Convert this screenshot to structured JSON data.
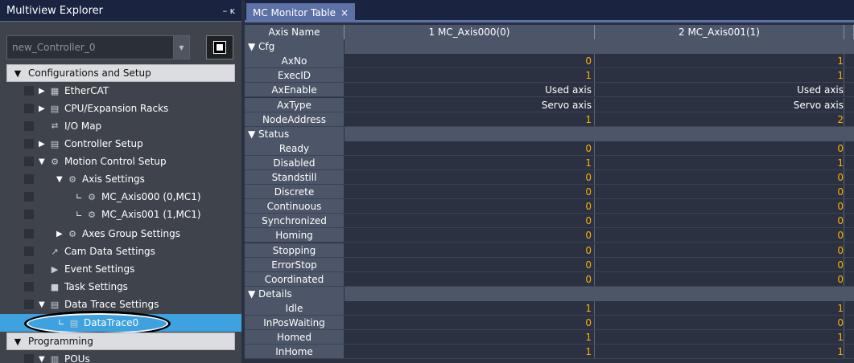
{
  "explorer": {
    "title": "Multiview Explorer",
    "pin_label": "– ĸ",
    "controller_select": "new_Controller_0",
    "sections": {
      "config": "Configurations and Setup",
      "programming": "Programming"
    },
    "tree": [
      {
        "label": "EtherCAT",
        "icon": "ethercat-icon",
        "glyph": "▦"
      },
      {
        "label": "CPU/Expansion Racks",
        "icon": "rack-icon",
        "glyph": "▤"
      },
      {
        "label": "I/O Map",
        "icon": "io-map-icon",
        "glyph": "⮂"
      },
      {
        "label": "Controller Setup",
        "icon": "controller-setup-icon",
        "glyph": "▤"
      },
      {
        "label": "Motion Control Setup",
        "icon": "motion-gear-icon",
        "glyph": "⚙"
      },
      {
        "label": "Axis Settings",
        "icon": "axis-gear-icon",
        "glyph": "⚙"
      },
      {
        "label": "MC_Axis000 (0,MC1)",
        "icon": "axis-icon",
        "glyph": "⚙"
      },
      {
        "label": "MC_Axis001 (1,MC1)",
        "icon": "axis-icon",
        "glyph": "⚙"
      },
      {
        "label": "Axes Group Settings",
        "icon": "axes-group-icon",
        "glyph": "⚙"
      },
      {
        "label": "Cam Data Settings",
        "icon": "cam-icon",
        "glyph": "↗"
      },
      {
        "label": "Event Settings",
        "icon": "event-flag-icon",
        "glyph": "▶"
      },
      {
        "label": "Task Settings",
        "icon": "task-icon",
        "glyph": "■"
      },
      {
        "label": "Data Trace Settings",
        "icon": "data-trace-icon",
        "glyph": "▤"
      },
      {
        "label": "DataTrace0",
        "icon": "trace-icon",
        "glyph": "▤"
      },
      {
        "label": "POUs",
        "icon": "pou-icon",
        "glyph": "▥"
      }
    ]
  },
  "monitor": {
    "tab_label": "MC Monitor Table",
    "tab_close": "×",
    "columns": [
      "Axis Name",
      "1 MC_Axis000(0)",
      "2 MC_Axis001(1)"
    ],
    "groups": [
      {
        "name": "Cfg",
        "rows": [
          {
            "name": "AxNo",
            "v1": "0",
            "v2": "1"
          },
          {
            "name": "ExecID",
            "v1": "1",
            "v2": "1"
          },
          {
            "name": "AxEnable",
            "v1": "Used axis",
            "v2": "Used axis"
          },
          {
            "name": "AxType",
            "v1": "Servo axis",
            "v2": "Servo axis"
          },
          {
            "name": "NodeAddress",
            "v1": "1",
            "v2": "2"
          }
        ]
      },
      {
        "name": "Status",
        "rows": [
          {
            "name": "Ready",
            "v1": "0",
            "v2": "0"
          },
          {
            "name": "Disabled",
            "v1": "1",
            "v2": "1"
          },
          {
            "name": "Standstill",
            "v1": "0",
            "v2": "0"
          },
          {
            "name": "Discrete",
            "v1": "0",
            "v2": "0"
          },
          {
            "name": "Continuous",
            "v1": "0",
            "v2": "0"
          },
          {
            "name": "Synchronized",
            "v1": "0",
            "v2": "0"
          },
          {
            "name": "Homing",
            "v1": "0",
            "v2": "0"
          },
          {
            "name": "Stopping",
            "v1": "0",
            "v2": "0"
          },
          {
            "name": "ErrorStop",
            "v1": "0",
            "v2": "0"
          },
          {
            "name": "Coordinated",
            "v1": "0",
            "v2": "0"
          }
        ]
      },
      {
        "name": "Details",
        "rows": [
          {
            "name": "Idle",
            "v1": "1",
            "v2": "1"
          },
          {
            "name": "InPosWaiting",
            "v1": "0",
            "v2": "0"
          },
          {
            "name": "Homed",
            "v1": "1",
            "v2": "1"
          },
          {
            "name": "InHome",
            "v1": "1",
            "v2": "1"
          }
        ]
      }
    ]
  },
  "colors": {
    "selection": "#3fa2e0",
    "value_orange": "#ffb000",
    "value_white": "#ffffff"
  }
}
